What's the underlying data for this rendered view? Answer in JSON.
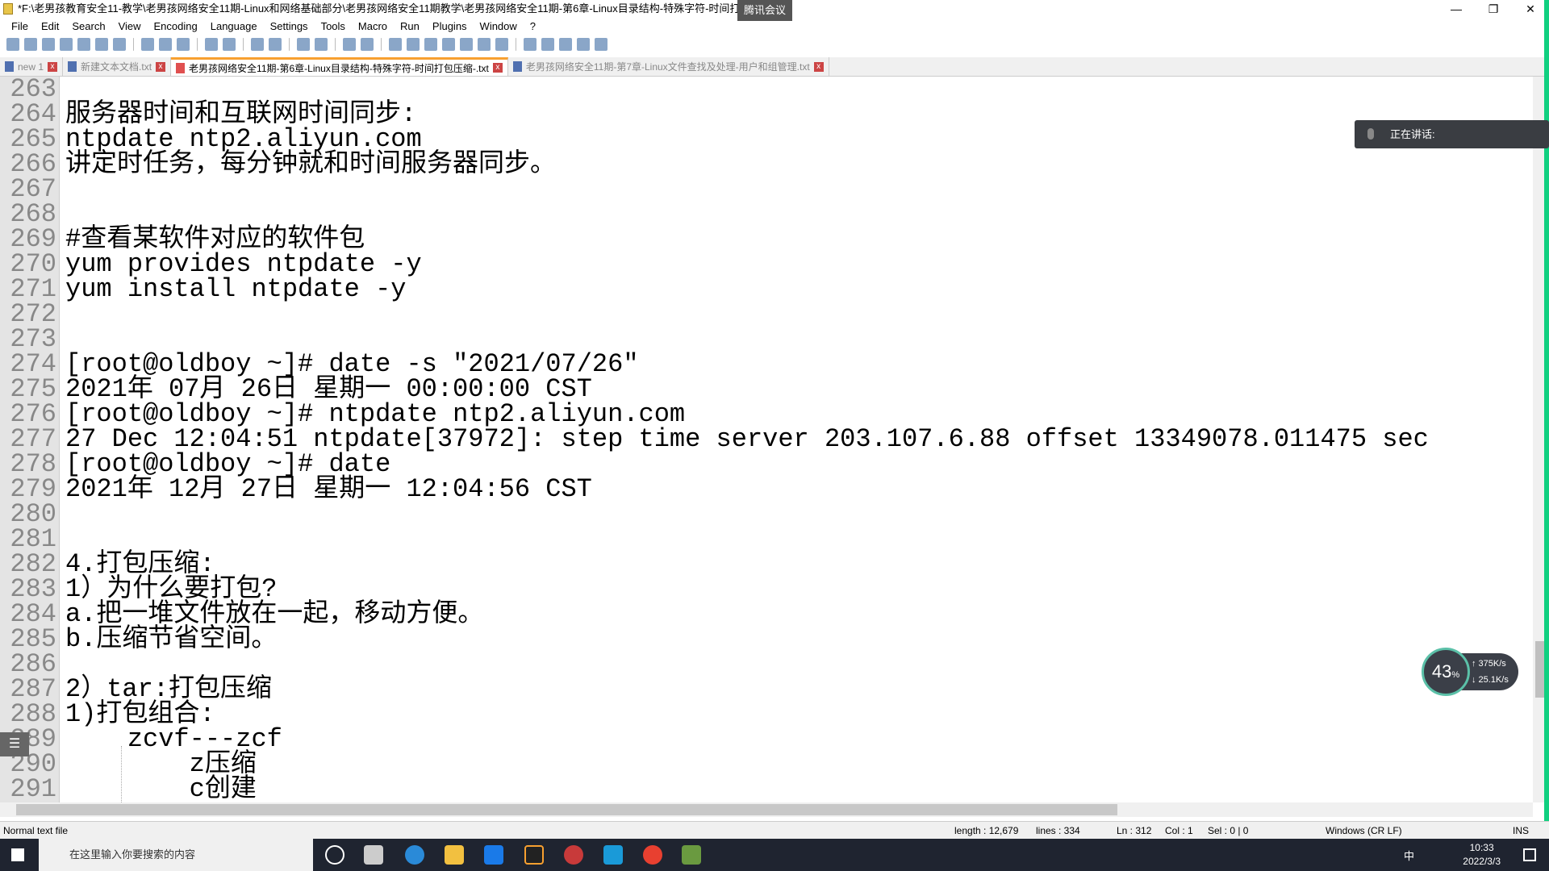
{
  "window": {
    "title": "*F:\\老男孩教育安全11-教学\\老男孩网络安全11期-Linux和网络基础部分\\老男孩网络安全11期教学\\老男孩网络安全11期-第6章-Linux目录结构-特殊字符-时间打包压缩-.txt",
    "meeting_badge": "腾讯会议",
    "min": "—",
    "max": "❐",
    "close": "✕"
  },
  "menu": [
    "File",
    "Edit",
    "Search",
    "View",
    "Encoding",
    "Language",
    "Settings",
    "Tools",
    "Macro",
    "Run",
    "Plugins",
    "Window",
    "?"
  ],
  "tabs": [
    {
      "label": "new 1",
      "active": false
    },
    {
      "label": "新建文本文档.txt",
      "active": false
    },
    {
      "label": "老男孩网络安全11期-第6章-Linux目录结构-特殊字符-时间打包压缩-.txt",
      "active": true
    },
    {
      "label": "老男孩网络安全11期-第7章-Linux文件查找及处理-用户和组管理.txt",
      "active": false
    }
  ],
  "lines": [
    {
      "n": "263",
      "t": ""
    },
    {
      "n": "264",
      "t": "服务器时间和互联网时间同步:"
    },
    {
      "n": "265",
      "t": "ntpdate ntp2.aliyun.com"
    },
    {
      "n": "266",
      "t": "讲定时任务，每分钟就和时间服务器同步。"
    },
    {
      "n": "267",
      "t": ""
    },
    {
      "n": "268",
      "t": ""
    },
    {
      "n": "269",
      "t": "#查看某软件对应的软件包"
    },
    {
      "n": "270",
      "t": "yum provides ntpdate -y"
    },
    {
      "n": "271",
      "t": "yum install ntpdate -y"
    },
    {
      "n": "272",
      "t": ""
    },
    {
      "n": "273",
      "t": ""
    },
    {
      "n": "274",
      "t": "[root@oldboy ~]# date -s \"2021/07/26\""
    },
    {
      "n": "275",
      "t": "2021年 07月 26日 星期一 00:00:00 CST"
    },
    {
      "n": "276",
      "t": "[root@oldboy ~]# ntpdate ntp2.aliyun.com"
    },
    {
      "n": "277",
      "t": "27 Dec 12:04:51 ntpdate[37972]: step time server 203.107.6.88 offset 13349078.011475 sec"
    },
    {
      "n": "278",
      "t": "[root@oldboy ~]# date"
    },
    {
      "n": "279",
      "t": "2021年 12月 27日 星期一 12:04:56 CST"
    },
    {
      "n": "280",
      "t": ""
    },
    {
      "n": "281",
      "t": ""
    },
    {
      "n": "282",
      "t": "4.打包压缩:"
    },
    {
      "n": "283",
      "t": "1）为什么要打包?"
    },
    {
      "n": "284",
      "t": "a.把一堆文件放在一起，移动方便。"
    },
    {
      "n": "285",
      "t": "b.压缩节省空间。"
    },
    {
      "n": "286",
      "t": ""
    },
    {
      "n": "287",
      "t": "2）tar:打包压缩"
    },
    {
      "n": "288",
      "t": "1)打包组合:"
    },
    {
      "n": "289",
      "t": "    zcvf---zcf"
    },
    {
      "n": "290",
      "t": "        z压缩"
    },
    {
      "n": "291",
      "t": "        c创建"
    }
  ],
  "status": {
    "type": "Normal text file",
    "length": "length : 12,679",
    "lines": "lines : 334",
    "ln": "Ln : 312",
    "col": "Col : 1",
    "sel": "Sel : 0 | 0",
    "eol": "Windows (CR LF)",
    "ins": "INS"
  },
  "overlay": {
    "speaking": "正在讲话:",
    "cpu": "43",
    "cpu_unit": "%",
    "up": "↑ 375K/s",
    "down": "↓ 25.1K/s"
  },
  "taskbar": {
    "search_placeholder": "在这里输入你要搜索的内容",
    "time": "10:33",
    "date": "2022/3/3",
    "ime": "中"
  }
}
